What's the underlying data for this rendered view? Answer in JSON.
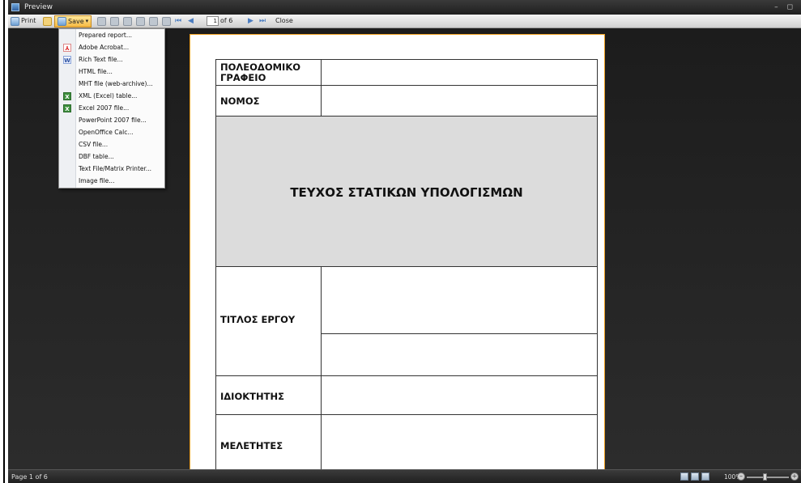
{
  "window": {
    "title": "Preview",
    "controls": "– ◻"
  },
  "toolbar": {
    "print_label": "Print",
    "save_label": "Save",
    "page_value": "1",
    "page_of": "of 6",
    "close_label": "Close"
  },
  "save_menu": {
    "items": [
      {
        "label": "Prepared report...",
        "icon": ""
      },
      {
        "label": "Adobe Acrobat...",
        "icon": "pdf-icon"
      },
      {
        "label": "Rich Text file...",
        "icon": "rtf-icon"
      },
      {
        "label": "HTML file...",
        "icon": ""
      },
      {
        "label": "MHT file (web-archive)...",
        "icon": ""
      },
      {
        "label": "XML (Excel) table...",
        "icon": "excel-icon"
      },
      {
        "label": "Excel 2007 file...",
        "icon": "excel-icon"
      },
      {
        "label": "PowerPoint 2007 file...",
        "icon": ""
      },
      {
        "label": "OpenOffice Calc...",
        "icon": ""
      },
      {
        "label": "CSV file...",
        "icon": ""
      },
      {
        "label": "DBF table...",
        "icon": ""
      },
      {
        "label": "Text File/Matrix Printer...",
        "icon": ""
      },
      {
        "label": "Image file...",
        "icon": ""
      }
    ]
  },
  "report": {
    "office_label": "ΠΟΛΕΟΔΟΜΙΚΟ ΓΡΑΦΕΙΟ",
    "prefecture_label": "ΝΟΜΟΣ",
    "main_title": "ΤΕΥΧΟΣ ΣΤΑΤΙΚΩΝ ΥΠΟΛΟΓΙΣΜΩΝ",
    "project_title_label": "ΤΙΤΛΟΣ ΕΡΓΟΥ",
    "owner_label": "ΙΔΙΟΚΤΗΤΗΣ",
    "engineers_label": "ΜΕΛΕΤΗΤΕΣ"
  },
  "status": {
    "page_text": "Page 1 of 6",
    "zoom": "100%"
  },
  "colors": {
    "save_highlight": "#f5b942",
    "page_border": "#f0a020",
    "title_band": "#dcdcdc"
  }
}
